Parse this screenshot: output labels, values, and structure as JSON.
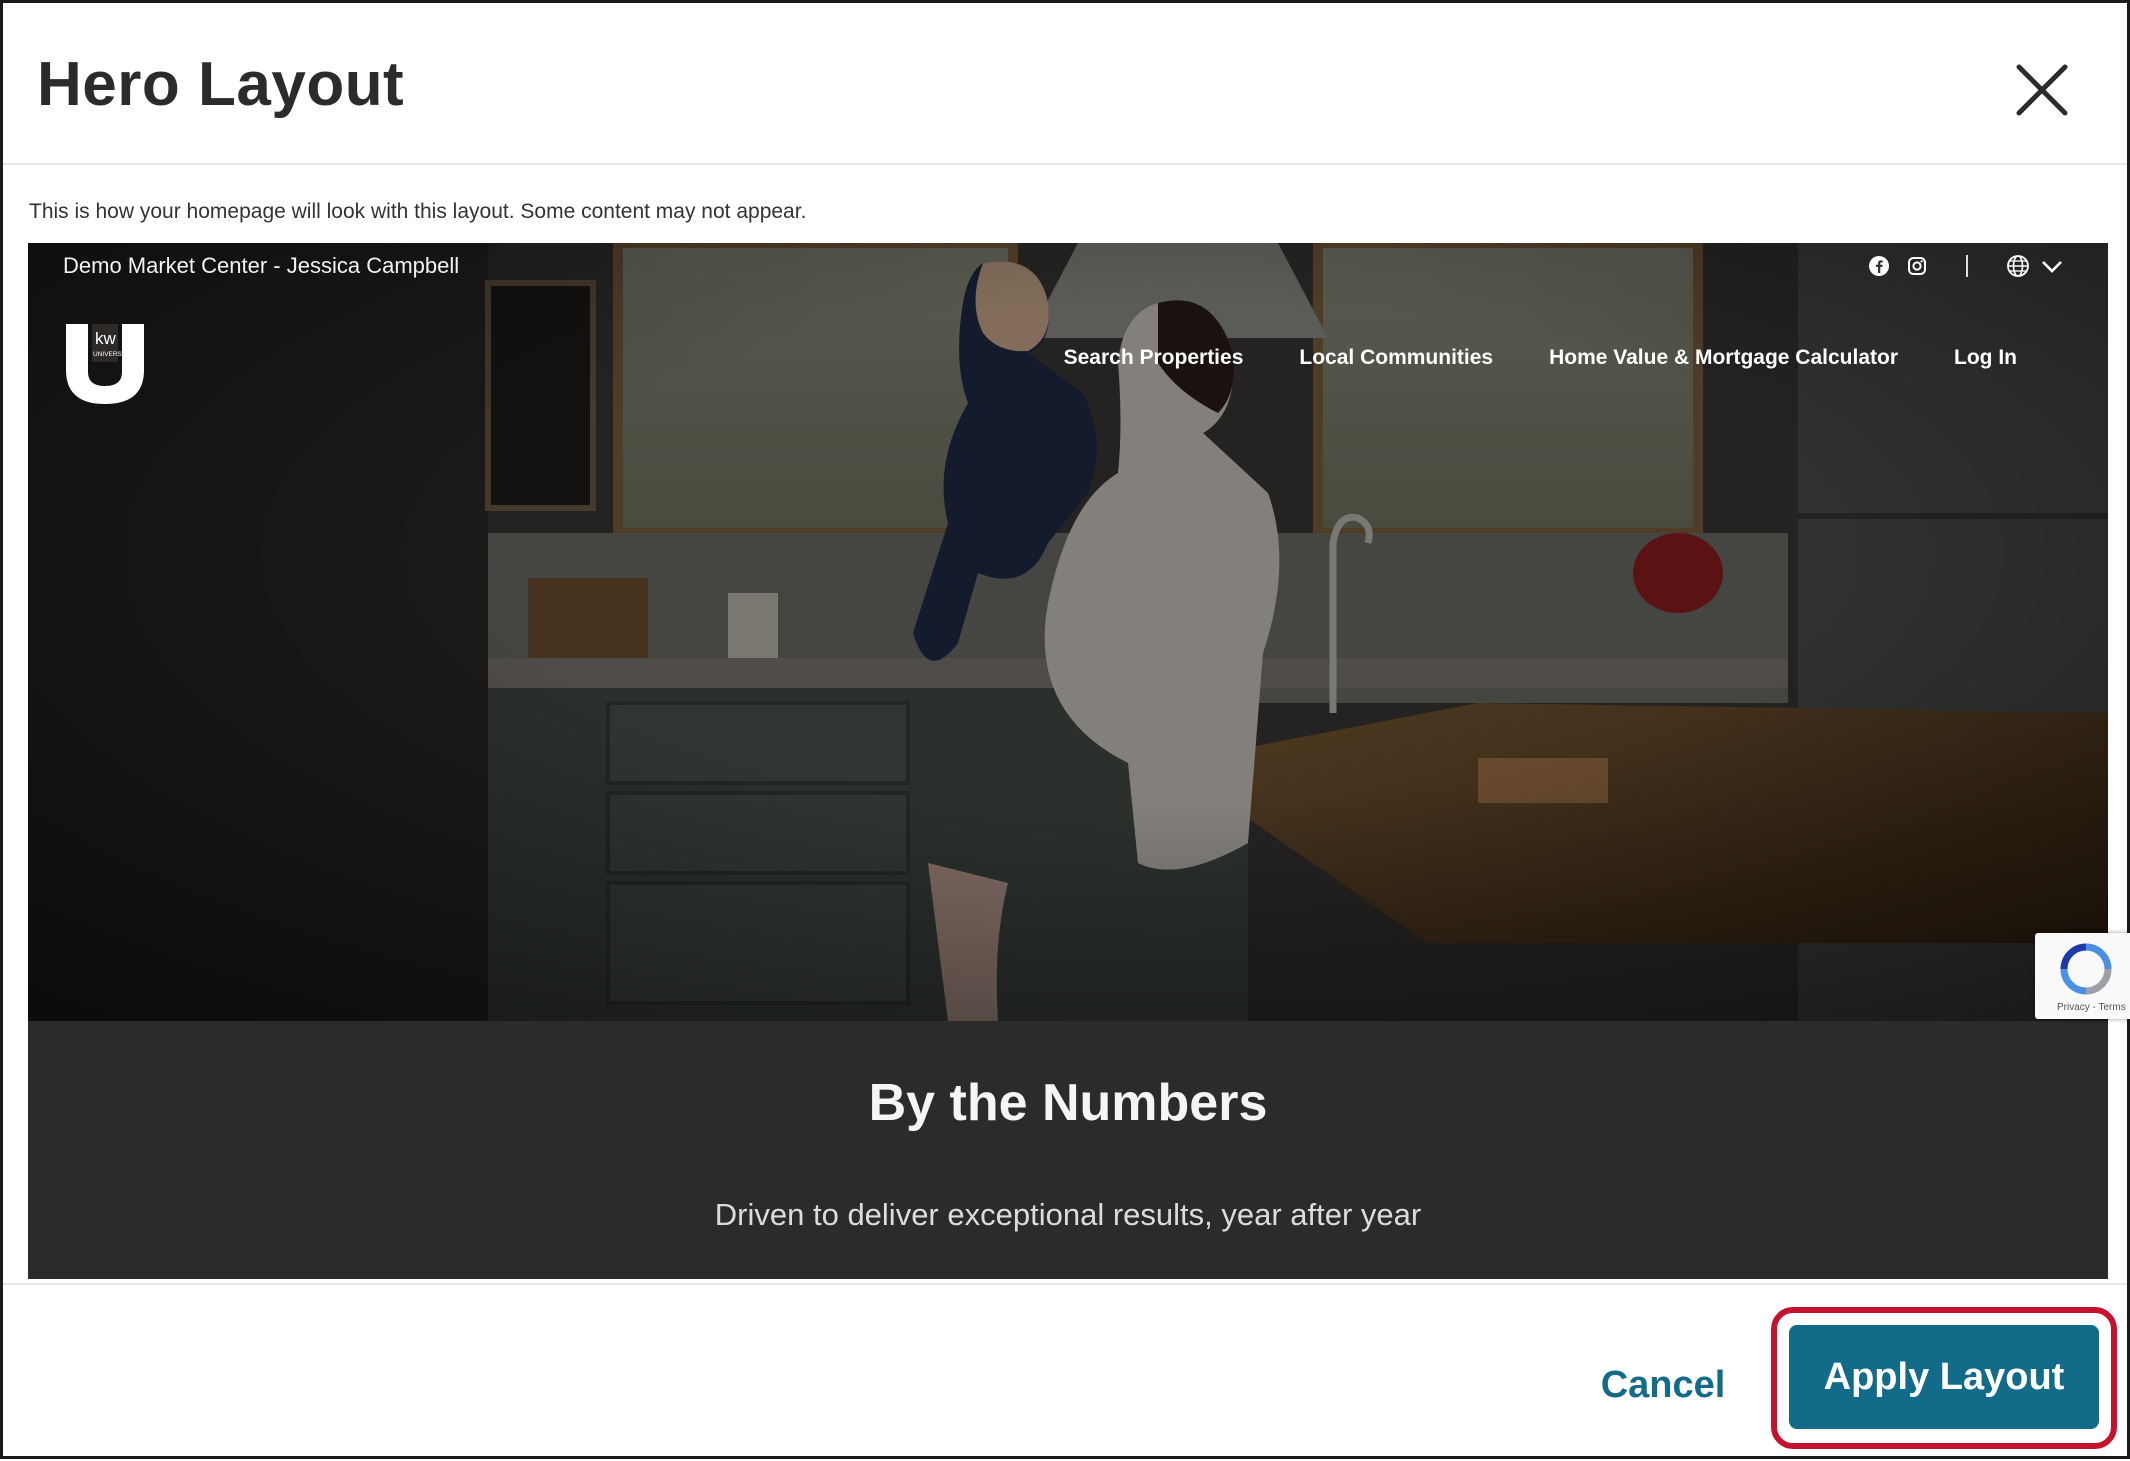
{
  "modal": {
    "title": "Hero Layout",
    "preview_note": "This is how your homepage will look with this layout. Some content may not appear."
  },
  "preview": {
    "site_name": "Demo Market Center - Jessica Campbell",
    "logo": {
      "text_kw": "kw",
      "text_university": "UNIVERSITY"
    },
    "social_icons": [
      "facebook-icon",
      "instagram-icon"
    ],
    "language_icon": "globe-icon",
    "nav": [
      "Search Properties",
      "Local Communities",
      "Home Value & Mortgage Calculator",
      "Log In"
    ],
    "section_title": "By the Numbers",
    "section_subtitle": "Driven to deliver exceptional results, year after year",
    "recaptcha_text": "Privacy - Terms"
  },
  "footer": {
    "cancel_label": "Cancel",
    "apply_label": "Apply Layout"
  },
  "colors": {
    "primary": "#136b8a",
    "highlight": "#c4122f",
    "section_bg": "#2b2b2b"
  }
}
